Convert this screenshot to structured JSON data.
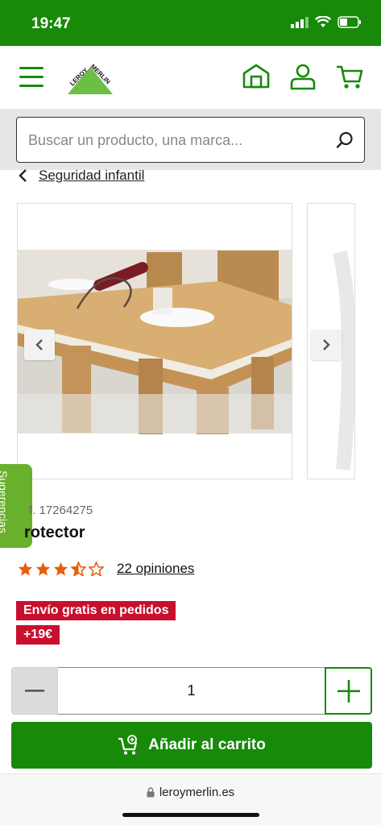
{
  "status_bar": {
    "time": "19:47"
  },
  "header": {
    "logo_text": "LEROY MERLIN",
    "icons": [
      "menu-icon",
      "store-icon",
      "user-icon",
      "cart-icon"
    ]
  },
  "search": {
    "placeholder": "Buscar un producto, una marca..."
  },
  "breadcrumb": {
    "label": "Seguridad infantil"
  },
  "sugerencias": {
    "label": "Sugerencias"
  },
  "product": {
    "ref": "f. 17264275",
    "title": "rotector",
    "rating": 3.5,
    "opinions": "22 opiniones"
  },
  "badges": {
    "line1": "Envío gratis en pedidos",
    "line2": "+19€"
  },
  "quantity": {
    "value": "1"
  },
  "cta": {
    "add_to_cart": "Añadir al carrito"
  },
  "browser": {
    "url": "leroymerlin.es"
  },
  "colors": {
    "brand_green": "#178a0a",
    "badge_red": "#c8102e",
    "star_orange": "#e85d0c",
    "tab_green": "#69b02c"
  }
}
